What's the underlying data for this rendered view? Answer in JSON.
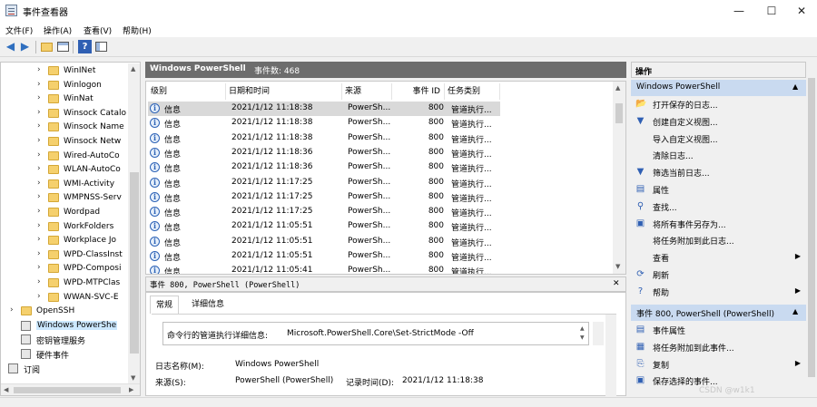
{
  "window": {
    "title": "事件查看器",
    "controls": {
      "minimize": "—",
      "maximize": "☐",
      "close": "✕"
    }
  },
  "menu": [
    "文件(F)",
    "操作(A)",
    "查看(V)",
    "帮助(H)"
  ],
  "toolbar": {
    "icons": [
      "back-arrow-icon",
      "forward-arrow-icon",
      "open-folder-icon",
      "grid-view-icon",
      "help-icon",
      "panel-icon"
    ],
    "help_glyph": "?"
  },
  "tree": {
    "items": [
      {
        "label": "WinINet",
        "type": "folder",
        "arrow": "›"
      },
      {
        "label": "Winlogon",
        "type": "folder",
        "arrow": "›"
      },
      {
        "label": "WinNat",
        "type": "folder",
        "arrow": "›"
      },
      {
        "label": "Winsock Catalo",
        "type": "folder",
        "arrow": "›"
      },
      {
        "label": "Winsock Name",
        "type": "folder",
        "arrow": "›"
      },
      {
        "label": "Winsock Netw",
        "type": "folder",
        "arrow": "›"
      },
      {
        "label": "Wired-AutoCo",
        "type": "folder",
        "arrow": "›"
      },
      {
        "label": "WLAN-AutoCo",
        "type": "folder",
        "arrow": "›"
      },
      {
        "label": "WMI-Activity",
        "type": "folder",
        "arrow": "›"
      },
      {
        "label": "WMPNSS-Serv",
        "type": "folder",
        "arrow": "›"
      },
      {
        "label": "Wordpad",
        "type": "folder",
        "arrow": "›"
      },
      {
        "label": "WorkFolders",
        "type": "folder",
        "arrow": "›"
      },
      {
        "label": "Workplace Jo",
        "type": "folder",
        "arrow": "›"
      },
      {
        "label": "WPD-ClassInst",
        "type": "folder",
        "arrow": "›"
      },
      {
        "label": "WPD-Composi",
        "type": "folder",
        "arrow": "›"
      },
      {
        "label": "WPD-MTPClas",
        "type": "folder",
        "arrow": "›"
      },
      {
        "label": "WWAN-SVC-E",
        "type": "folder",
        "arrow": "›"
      },
      {
        "label": "OpenSSH",
        "type": "folder",
        "arrow": "›"
      },
      {
        "label": "Windows PowerShe",
        "type": "log",
        "arrow": ""
      },
      {
        "label": "密钥管理服务",
        "type": "log",
        "arrow": ""
      },
      {
        "label": "硬件事件",
        "type": "log",
        "arrow": ""
      },
      {
        "label": "订阅",
        "type": "log",
        "arrow": ""
      }
    ],
    "scroll_up": "▲",
    "scroll_down": "▼",
    "scroll_left": "◀",
    "scroll_right": "▶"
  },
  "center": {
    "log_name": "Windows PowerShell",
    "event_count": "事件数: 468"
  },
  "table": {
    "columns": [
      "级别",
      "日期和时间",
      "来源",
      "事件 ID",
      "任务类别"
    ],
    "rows": [
      {
        "level": "信息",
        "datetime": "2021/1/12 11:18:38",
        "source": "PowerSh...",
        "id": "800",
        "task": "管道执行..."
      },
      {
        "level": "信息",
        "datetime": "2021/1/12 11:18:38",
        "source": "PowerSh...",
        "id": "800",
        "task": "管道执行..."
      },
      {
        "level": "信息",
        "datetime": "2021/1/12 11:18:38",
        "source": "PowerSh...",
        "id": "800",
        "task": "管道执行..."
      },
      {
        "level": "信息",
        "datetime": "2021/1/12 11:18:36",
        "source": "PowerSh...",
        "id": "800",
        "task": "管道执行..."
      },
      {
        "level": "信息",
        "datetime": "2021/1/12 11:18:36",
        "source": "PowerSh...",
        "id": "800",
        "task": "管道执行..."
      },
      {
        "level": "信息",
        "datetime": "2021/1/12 11:17:25",
        "source": "PowerSh...",
        "id": "800",
        "task": "管道执行..."
      },
      {
        "level": "信息",
        "datetime": "2021/1/12 11:17:25",
        "source": "PowerSh...",
        "id": "800",
        "task": "管道执行..."
      },
      {
        "level": "信息",
        "datetime": "2021/1/12 11:17:25",
        "source": "PowerSh...",
        "id": "800",
        "task": "管道执行..."
      },
      {
        "level": "信息",
        "datetime": "2021/1/12 11:05:51",
        "source": "PowerSh...",
        "id": "800",
        "task": "管道执行..."
      },
      {
        "level": "信息",
        "datetime": "2021/1/12 11:05:51",
        "source": "PowerSh...",
        "id": "800",
        "task": "管道执行..."
      },
      {
        "level": "信息",
        "datetime": "2021/1/12 11:05:51",
        "source": "PowerSh...",
        "id": "800",
        "task": "管道执行..."
      },
      {
        "level": "信息",
        "datetime": "2021/1/12 11:05:41",
        "source": "PowerSh...",
        "id": "800",
        "task": "管道执行..."
      }
    ],
    "info_glyph": "i"
  },
  "detail": {
    "header": "事件 800, PowerShell (PowerShell)",
    "tabs": [
      "常规",
      "详细信息"
    ],
    "message_label": "命令行的管道执行详细信息:",
    "message_value": "Microsoft.PowerShell.Core\\Set-StrictMode -Off",
    "log_name_label": "日志名称(M):",
    "log_name_value": "Windows PowerShell",
    "source_label": "来源(S):",
    "source_value": "PowerShell (PowerShell)",
    "recorded_label": "记录时间(D):",
    "recorded_value": "2021/1/12 11:18:38",
    "close_glyph": "✕"
  },
  "actions": {
    "title": "操作",
    "section1": "Windows PowerShell",
    "items1": [
      {
        "label": "打开保存的日志...",
        "icon": "open-folder-icon",
        "glyph": "📂",
        "submenu": false
      },
      {
        "label": "创建自定义视图...",
        "icon": "filter-icon",
        "glyph": "▼",
        "submenu": false
      },
      {
        "label": "导入自定义视图...",
        "icon": "",
        "glyph": "",
        "submenu": false
      },
      {
        "label": "清除日志...",
        "icon": "",
        "glyph": "",
        "submenu": false
      },
      {
        "label": "筛选当前日志...",
        "icon": "filter-icon",
        "glyph": "▼",
        "submenu": false
      },
      {
        "label": "属性",
        "icon": "properties-icon",
        "glyph": "▤",
        "submenu": false
      },
      {
        "label": "查找...",
        "icon": "find-icon",
        "glyph": "⚲",
        "submenu": false
      },
      {
        "label": "将所有事件另存为...",
        "icon": "save-icon",
        "glyph": "▣",
        "submenu": false
      },
      {
        "label": "将任务附加到此日志...",
        "icon": "",
        "glyph": "",
        "submenu": false
      },
      {
        "label": "查看",
        "icon": "",
        "glyph": "",
        "submenu": true
      },
      {
        "label": "刷新",
        "icon": "refresh-icon",
        "glyph": "⟳",
        "submenu": false
      },
      {
        "label": "帮助",
        "icon": "help-icon",
        "glyph": "?",
        "submenu": true
      }
    ],
    "section2": "事件 800, PowerShell (PowerShell)",
    "items2": [
      {
        "label": "事件属性",
        "icon": "properties-icon",
        "glyph": "▤",
        "submenu": false
      },
      {
        "label": "将任务附加到此事件...",
        "icon": "task-icon",
        "glyph": "▦",
        "submenu": false
      },
      {
        "label": "复制",
        "icon": "copy-icon",
        "glyph": "⎘",
        "submenu": true
      },
      {
        "label": "保存选择的事件...",
        "icon": "save-icon",
        "glyph": "▣",
        "submenu": false
      }
    ],
    "collapse_glyph": "▲",
    "submenu_glyph": "▶"
  },
  "watermark": "CSDN @w1k1"
}
